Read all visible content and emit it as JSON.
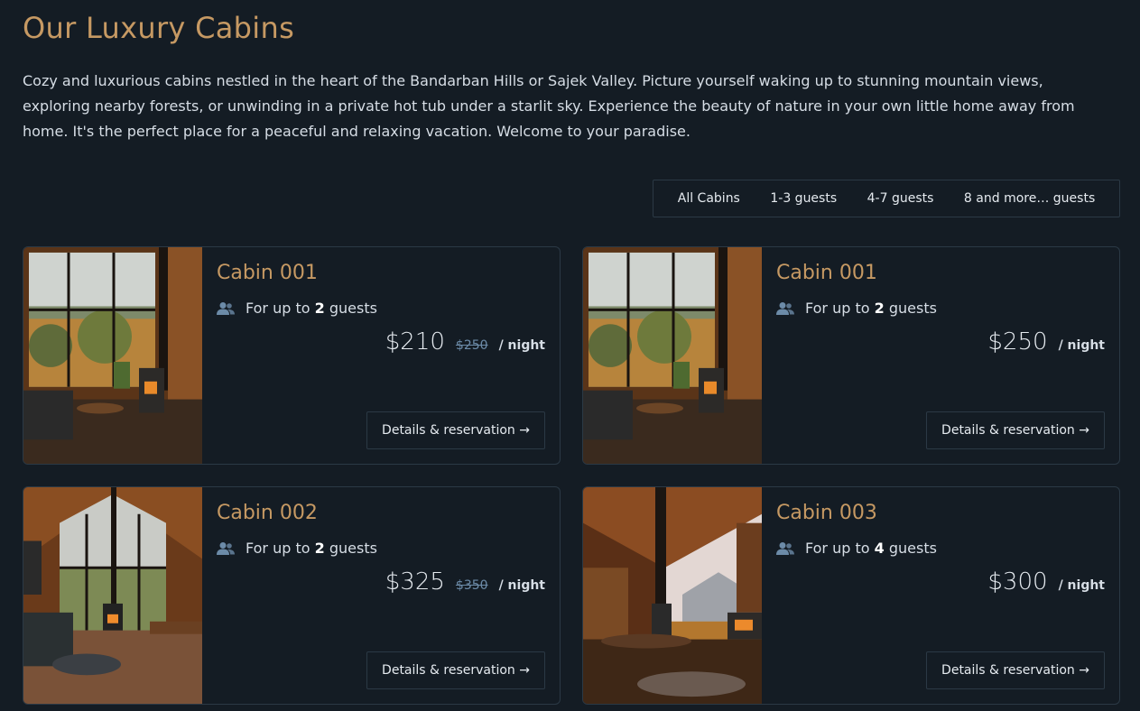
{
  "header": {
    "title": "Our Luxury Cabins",
    "intro": "Cozy and luxurious cabins nestled in the heart of the Bandarban Hills or Sajek Valley. Picture yourself waking up to stunning mountain views, exploring nearby forests, or unwinding in a private hot tub under a starlit sky. Experience the beauty of nature in your own little home away from home. It's the perfect place for a peaceful and relaxing vacation. Welcome to your paradise."
  },
  "filter": {
    "options": [
      "All Cabins",
      "1-3 guests",
      "4-7 guests",
      "8 and more… guests"
    ]
  },
  "cabins": [
    {
      "name": "Cabin 001",
      "guests_prefix": "For up to",
      "guests": "2",
      "guests_suffix": "guests",
      "price": "$210",
      "old_price": "$250",
      "per_night": "/ night",
      "cta": "Details & reservation →"
    },
    {
      "name": "Cabin 001",
      "guests_prefix": "For up to",
      "guests": "2",
      "guests_suffix": "guests",
      "price": "$250",
      "old_price": "",
      "per_night": "/ night",
      "cta": "Details & reservation →"
    },
    {
      "name": "Cabin 002",
      "guests_prefix": "For up to",
      "guests": "2",
      "guests_suffix": "guests",
      "price": "$325",
      "old_price": "$350",
      "per_night": "/ night",
      "cta": "Details & reservation →"
    },
    {
      "name": "Cabin 003",
      "guests_prefix": "For up to",
      "guests": "4",
      "guests_suffix": "guests",
      "price": "$300",
      "old_price": "",
      "per_night": "/ night",
      "cta": "Details & reservation →"
    }
  ],
  "colors": {
    "background": "#141c24",
    "accent": "#c69963",
    "border": "#2b3945",
    "icon": "#6c8ba8"
  },
  "icons": {
    "guests": "users-icon"
  }
}
